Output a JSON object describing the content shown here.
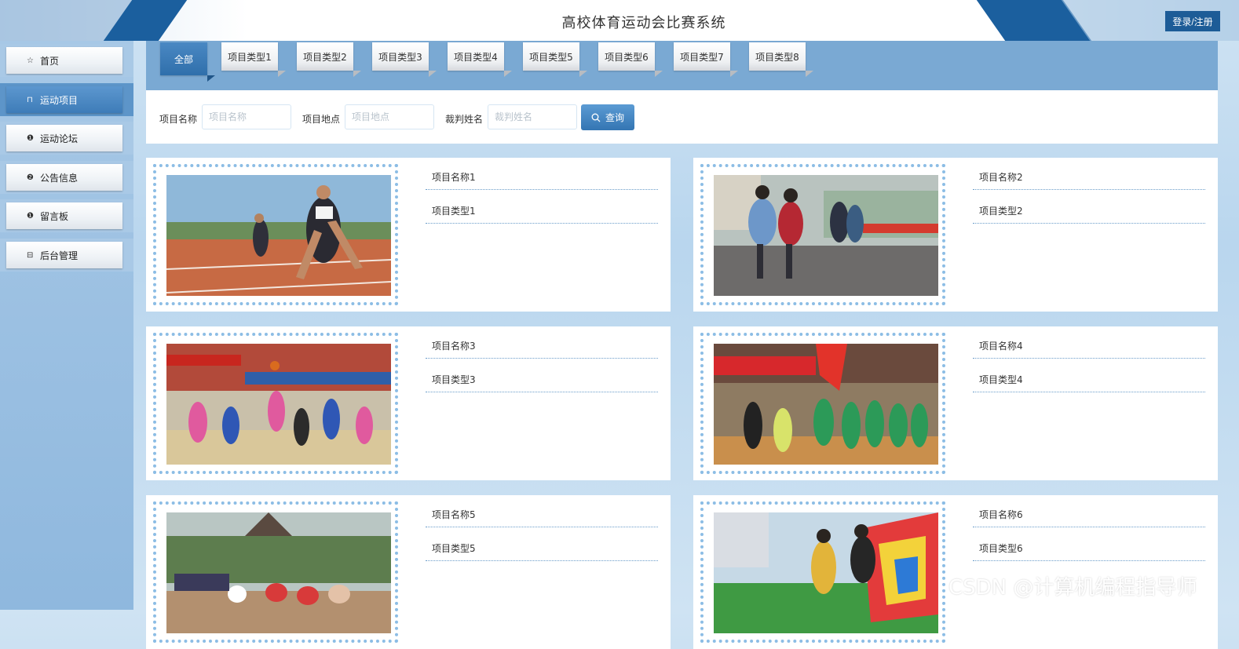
{
  "header": {
    "title": "高校体育运动会比赛系统",
    "login_label": "登录/注册"
  },
  "sidebar": {
    "items": [
      {
        "label": "首页",
        "icon": "star-icon",
        "glyph": "☆"
      },
      {
        "label": "运动项目",
        "icon": "lock-icon",
        "glyph": "⊓"
      },
      {
        "label": "运动论坛",
        "icon": "alert-icon",
        "glyph": "❶"
      },
      {
        "label": "公告信息",
        "icon": "help-icon",
        "glyph": "❷"
      },
      {
        "label": "留言板",
        "icon": "info-icon",
        "glyph": "❶"
      },
      {
        "label": "后台管理",
        "icon": "calendar-icon",
        "glyph": "⊟"
      }
    ],
    "active_index": 1
  },
  "tabs": [
    "全部",
    "项目类型1",
    "项目类型2",
    "项目类型3",
    "项目类型4",
    "项目类型5",
    "项目类型6",
    "项目类型7",
    "项目类型8"
  ],
  "search": {
    "name_label": "项目名称",
    "name_placeholder": "项目名称",
    "location_label": "项目地点",
    "location_placeholder": "项目地点",
    "referee_label": "裁判姓名",
    "referee_placeholder": "裁判姓名",
    "button_label": "查询"
  },
  "cards": [
    {
      "name": "项目名称1",
      "type": "项目类型1"
    },
    {
      "name": "项目名称2",
      "type": "项目类型2"
    },
    {
      "name": "项目名称3",
      "type": "项目类型3"
    },
    {
      "name": "项目名称4",
      "type": "项目类型4"
    },
    {
      "name": "项目名称5",
      "type": "项目类型5"
    },
    {
      "name": "项目名称6",
      "type": "项目类型6"
    }
  ],
  "watermark": "CSDN @计算机编程指导师",
  "colors": {
    "primary": "#1d5c97",
    "accent": "#3e7cb8",
    "panel": "#7aa9d3"
  }
}
